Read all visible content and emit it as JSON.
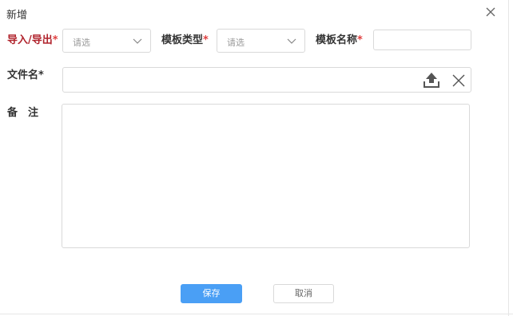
{
  "dialog": {
    "title": "新增"
  },
  "form": {
    "direction": {
      "label": "导入/导出",
      "required_mark": "*",
      "placeholder": "请选"
    },
    "template_type": {
      "label": "模板类型",
      "required_mark": "*",
      "placeholder": "请选"
    },
    "template_name": {
      "label": "模板名称",
      "required_mark": "*",
      "value": ""
    },
    "file_name": {
      "label": "文件名",
      "required_mark": "*",
      "value": ""
    },
    "remark": {
      "label": "备　注",
      "value": ""
    }
  },
  "buttons": {
    "save": "保存",
    "cancel": "取消"
  },
  "icons": {
    "close": "close-icon",
    "upload": "upload-icon",
    "clear": "clear-icon",
    "chevron": "chevron-down-icon"
  },
  "colors": {
    "primary": "#4a9ff5",
    "direction_label": "#b0232c",
    "required": "#e04040"
  }
}
